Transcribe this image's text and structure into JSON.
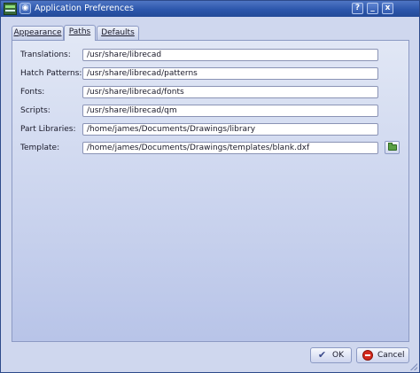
{
  "window": {
    "title": "Application Preferences",
    "buttons": [
      "?",
      "_",
      "x"
    ]
  },
  "tabs": [
    {
      "label": "Appearance",
      "active": false
    },
    {
      "label": "Paths",
      "active": true
    },
    {
      "label": "Defaults",
      "active": false
    }
  ],
  "paths": {
    "rows": [
      {
        "label": "Translations:",
        "value": "/usr/share/librecad"
      },
      {
        "label": "Hatch Patterns:",
        "value": "/usr/share/librecad/patterns"
      },
      {
        "label": "Fonts:",
        "value": "/usr/share/librecad/fonts"
      },
      {
        "label": "Scripts:",
        "value": "/usr/share/librecad/qm"
      },
      {
        "label": "Part Libraries:",
        "value": "/home/james/Documents/Drawings/library"
      },
      {
        "label": "Template:",
        "value": "/home/james/Documents/Drawings/templates/blank.dxf"
      }
    ]
  },
  "footer": {
    "ok_label": "OK",
    "cancel_label": "Cancel"
  },
  "icons": {
    "app": "librecad-app-icon",
    "pin": "pin-icon",
    "browse": "folder-open-icon",
    "ok": "checkmark-icon",
    "cancel": "cancel-icon"
  },
  "colors": {
    "titlebar": "#2c56ab",
    "dialog_bg": "#cfd7ee",
    "panel_bg": "#e1e7f5",
    "cancel_red": "#d42a1e"
  }
}
